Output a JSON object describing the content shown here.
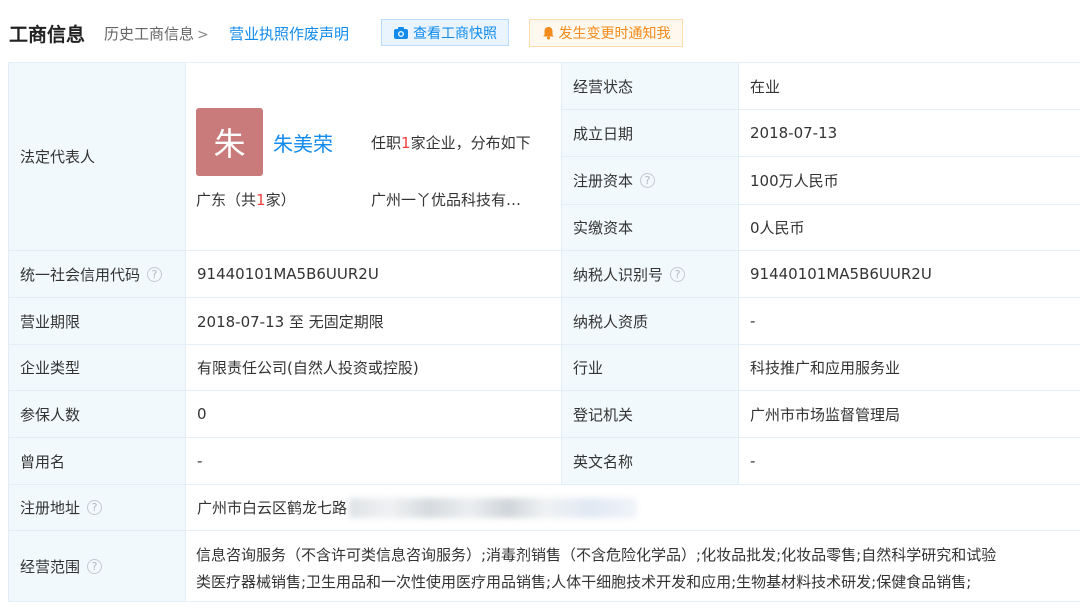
{
  "header": {
    "title": "工商信息",
    "history": "历史工商信息",
    "void_statement": "营业执照作废声明",
    "snapshot_button": "查看工商快照",
    "notify_button": "发生变更时通知我"
  },
  "legal_rep": {
    "label": "法定代表人",
    "avatar_char": "朱",
    "name": "朱美荣",
    "roles_prefix": "任职",
    "roles_count": "1",
    "roles_suffix": "家企业，分布如下",
    "region_prefix": "广东（共",
    "region_count": "1",
    "region_suffix": "家）",
    "company": "广州一丫优品科技有…"
  },
  "fields": {
    "status": {
      "label": "经营状态",
      "value": "在业"
    },
    "founded": {
      "label": "成立日期",
      "value": "2018-07-13"
    },
    "reg_capital": {
      "label": "注册资本",
      "value": "100万人民币"
    },
    "paid_capital": {
      "label": "实缴资本",
      "value": "0人民币"
    },
    "credit_code": {
      "label": "统一社会信用代码",
      "value": "91440101MA5B6UUR2U"
    },
    "taxpayer_id": {
      "label": "纳税人识别号",
      "value": "91440101MA5B6UUR2U"
    },
    "term": {
      "label": "营业期限",
      "value": "2018-07-13 至 无固定期限"
    },
    "taxpayer_qual": {
      "label": "纳税人资质",
      "value": "-"
    },
    "company_type": {
      "label": "企业类型",
      "value": "有限责任公司(自然人投资或控股)"
    },
    "industry": {
      "label": "行业",
      "value": "科技推广和应用服务业"
    },
    "insured": {
      "label": "参保人数",
      "value": "0"
    },
    "authority": {
      "label": "登记机关",
      "value": "广州市市场监督管理局"
    },
    "former_name": {
      "label": "曾用名",
      "value": "-"
    },
    "english_name": {
      "label": "英文名称",
      "value": "-"
    },
    "address": {
      "label": "注册地址",
      "value": "广州市白云区鹤龙七路"
    },
    "scope": {
      "label": "经营范围",
      "line1": "信息咨询服务（不含许可类信息咨询服务）;消毒剂销售（不含危险化学品）;化妆品批发;化妆品零售;自然科学研究和试验",
      "line2": "类医疗器械销售;卫生用品和一次性使用医疗用品销售;人体干细胞技术开发和应用;生物基材料技术研发;保健食品销售;"
    }
  },
  "help_glyph": "?"
}
